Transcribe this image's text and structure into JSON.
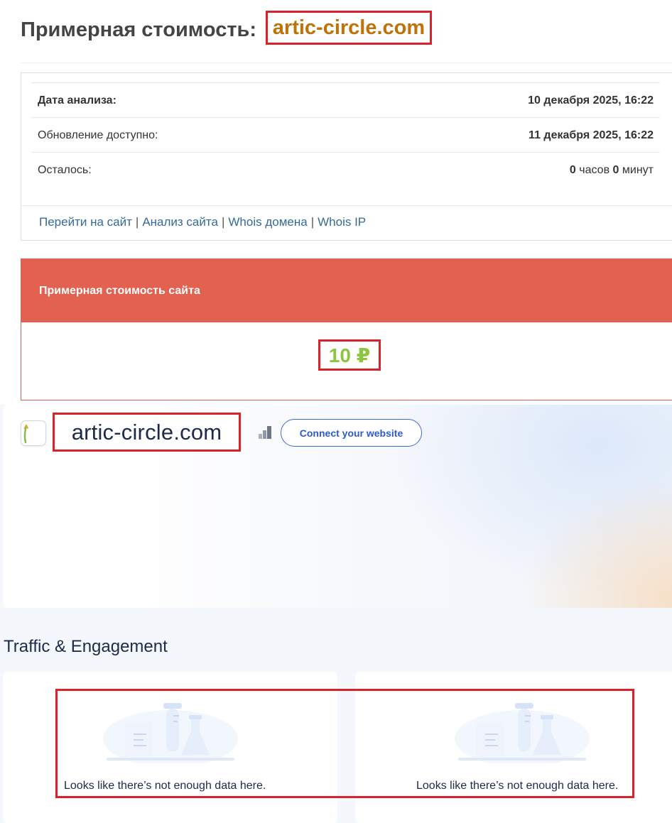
{
  "header": {
    "title_prefix": "Примерная стоимость:",
    "domain": "artic-circle.com"
  },
  "info": {
    "rows": [
      {
        "label": "Дата анализа:",
        "value": "10 декабря 2025, 16:22"
      },
      {
        "label": "Обновление доступно:",
        "value": "11 декабря 2025, 16:22"
      }
    ],
    "remaining": {
      "label": "Осталось:",
      "hours": "0",
      "hours_unit": "часов",
      "minutes": "0",
      "minutes_unit": "минут"
    },
    "links": [
      "Перейти на сайт",
      "Анализ сайта",
      "Whois домена",
      "Whois IP"
    ],
    "separator": "|"
  },
  "cost": {
    "header": "Примерная стоимость сайта",
    "value": "10 ₽",
    "value_color": "#8cc63f",
    "header_color": "#e36150"
  },
  "site": {
    "domain": "artic-circle.com",
    "rank_icon": "rank-bars-icon",
    "connect_label": "Connect your website"
  },
  "traffic": {
    "heading": "Traffic & Engagement",
    "cards": [
      {
        "message": "Looks like there’s not enough data here.",
        "illustration": "lab-flasks-illustration"
      },
      {
        "message": "Looks like there’s not enough data here.",
        "illustration": "lab-flasks-illustration"
      }
    ]
  },
  "colors": {
    "highlight_border": "#d9222a",
    "domain_orange": "#c0720a",
    "link_blue": "#356a9a",
    "button_blue": "#2c5ad0"
  }
}
